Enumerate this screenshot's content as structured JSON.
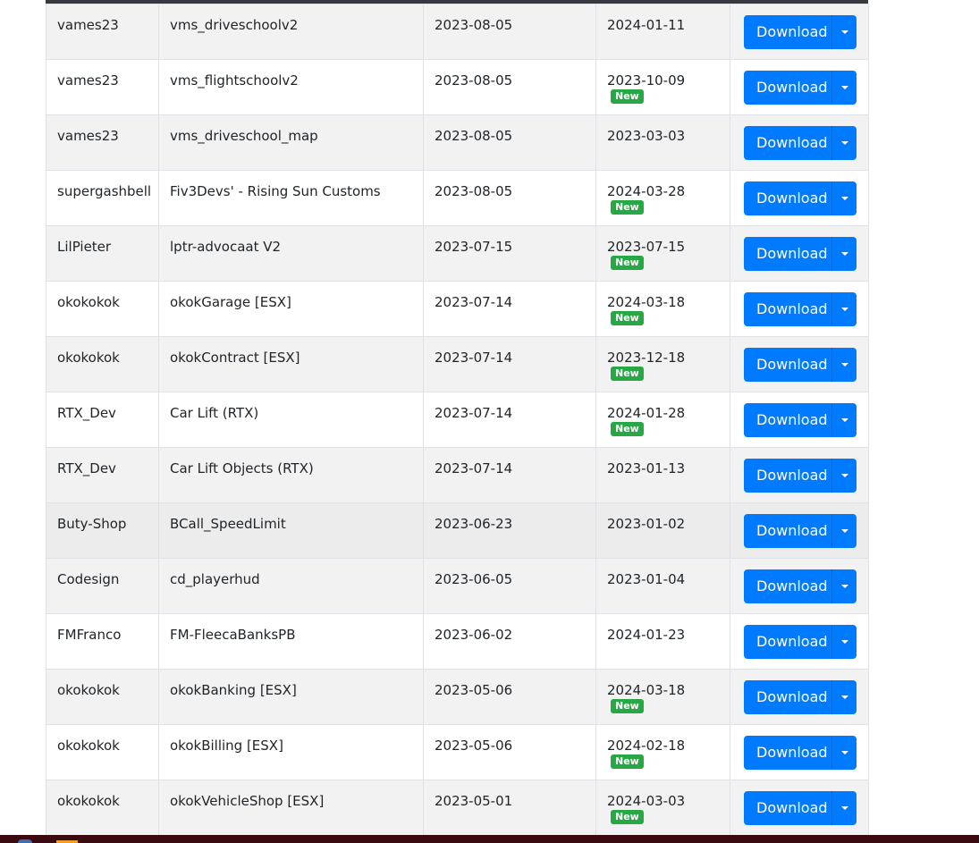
{
  "table": {
    "rows": [
      {
        "author": "vames23",
        "name": "vms_driveschoolv2",
        "added": "2023-08-05",
        "updated": "2024-01-11",
        "is_new": false
      },
      {
        "author": "vames23",
        "name": "vms_flightschoolv2",
        "added": "2023-08-05",
        "updated": "2023-10-09",
        "is_new": true
      },
      {
        "author": "vames23",
        "name": "vms_driveschool_map",
        "added": "2023-08-05",
        "updated": "2023-03-03",
        "is_new": false
      },
      {
        "author": "supergashbell",
        "name": "Fiv3Devs' - Rising Sun Customs",
        "added": "2023-08-05",
        "updated": "2024-03-28",
        "is_new": true
      },
      {
        "author": "LilPieter",
        "name": "lptr-advocaat V2",
        "added": "2023-07-15",
        "updated": "2023-07-15",
        "is_new": true
      },
      {
        "author": "okokokok",
        "name": "okokGarage [ESX]",
        "added": "2023-07-14",
        "updated": "2024-03-18",
        "is_new": true
      },
      {
        "author": "okokokok",
        "name": "okokContract [ESX]",
        "added": "2023-07-14",
        "updated": "2023-12-18",
        "is_new": true
      },
      {
        "author": "RTX_Dev",
        "name": "Car Lift (RTX)",
        "added": "2023-07-14",
        "updated": "2024-01-28",
        "is_new": true
      },
      {
        "author": "RTX_Dev",
        "name": "Car Lift Objects (RTX)",
        "added": "2023-07-14",
        "updated": "2023-01-13",
        "is_new": false
      },
      {
        "author": "Buty-Shop",
        "name": "BCall_SpeedLimit",
        "added": "2023-06-23",
        "updated": "2023-01-02",
        "is_new": false
      },
      {
        "author": "Codesign",
        "name": "cd_playerhud",
        "added": "2023-06-05",
        "updated": "2023-01-04",
        "is_new": false
      },
      {
        "author": "FMFranco",
        "name": "FM-FleecaBanksPB",
        "added": "2023-06-02",
        "updated": "2024-01-23",
        "is_new": false
      },
      {
        "author": "okokokok",
        "name": "okokBanking [ESX]",
        "added": "2023-05-06",
        "updated": "2024-03-18",
        "is_new": true
      },
      {
        "author": "okokokok",
        "name": "okokBilling [ESX]",
        "added": "2023-05-06",
        "updated": "2024-02-18",
        "is_new": true
      },
      {
        "author": "okokokok",
        "name": "okokVehicleShop [ESX]",
        "added": "2023-05-01",
        "updated": "2024-03-03",
        "is_new": true
      }
    ],
    "download_label": "Download",
    "new_badge_label": "New"
  },
  "colors": {
    "primary": "#007bff",
    "badge_new": "#28a745",
    "header_rule": "#343a40",
    "stripe": "#f2f2f2",
    "taskbar": "#3a0a10"
  },
  "icons": {
    "dropdown": "caret-down-icon"
  }
}
